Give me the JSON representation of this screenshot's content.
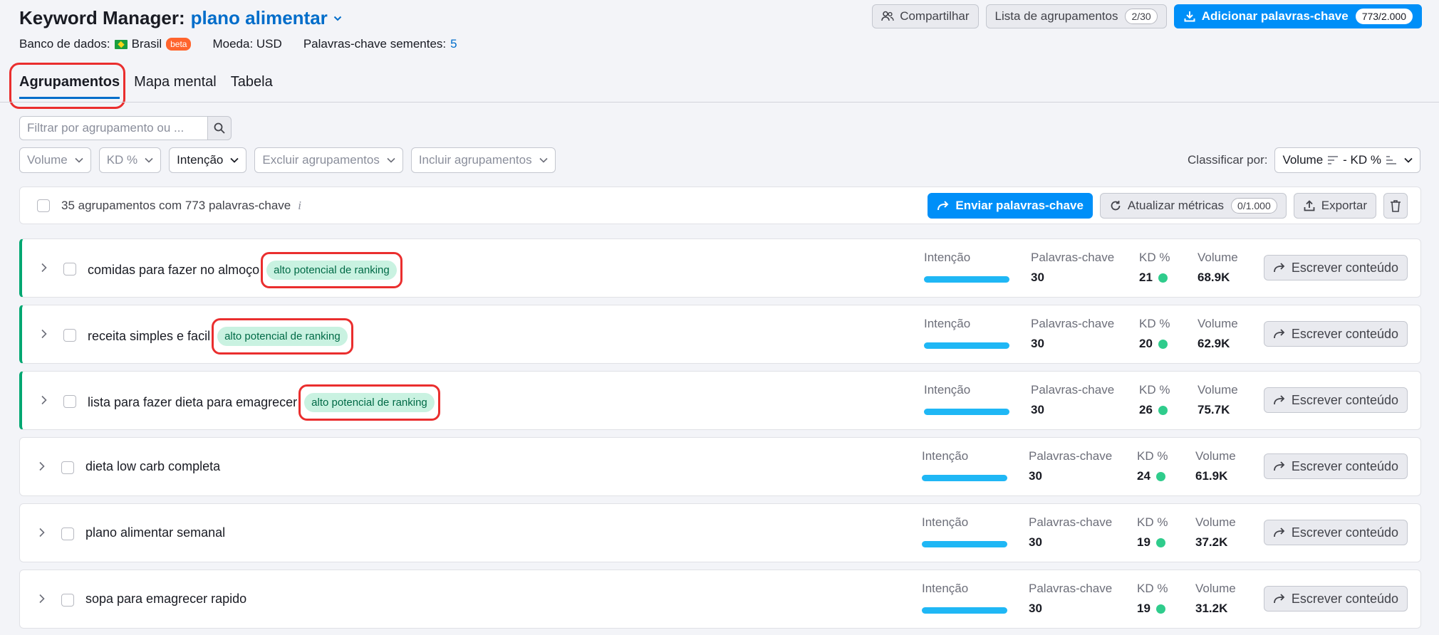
{
  "header": {
    "app_title": "Keyword Manager:",
    "project_name": "plano alimentar",
    "database_label": "Banco de dados:",
    "database_value": "Brasil",
    "beta": "beta",
    "currency": "Moeda: USD",
    "seed_label": "Palavras-chave sementes:",
    "seed_count": "5",
    "share_label": "Compartilhar",
    "groups_list_label": "Lista de agrupamentos",
    "groups_list_count": "2/30",
    "add_keywords_label": "Adicionar palavras-chave",
    "add_keywords_count": "773/2.000"
  },
  "tabs": [
    {
      "label": "Agrupamentos",
      "active": true
    },
    {
      "label": "Mapa mental",
      "active": false
    },
    {
      "label": "Tabela",
      "active": false
    }
  ],
  "search": {
    "placeholder": "Filtrar por agrupamento ou ..."
  },
  "filters": [
    "Volume",
    "KD %",
    "Intenção",
    "Excluir agrupamentos",
    "Incluir agrupamentos"
  ],
  "sort": {
    "label": "Classificar por:",
    "value_a": "Volume",
    "value_b": "- KD %"
  },
  "toolbar": {
    "summary": "35 agrupamentos com 773 palavras-chave",
    "info": "i",
    "send_label": "Enviar palavras-chave",
    "update_label": "Atualizar métricas",
    "update_count": "0/1.000",
    "export_label": "Exportar"
  },
  "labels": {
    "intent": "Intenção",
    "keywords": "Palavras-chave",
    "kd": "KD %",
    "volume": "Volume",
    "write": "Escrever conteúdo"
  },
  "rows": [
    {
      "name": "comidas para fazer no almoço",
      "tag": "alto potencial de ranking",
      "keywords": "30",
      "kd": "21",
      "volume": "68.9K"
    },
    {
      "name": "receita simples e facil",
      "tag": "alto potencial de ranking",
      "keywords": "30",
      "kd": "20",
      "volume": "62.9K"
    },
    {
      "name": "lista para fazer dieta para emagrecer",
      "tag": "alto potencial de ranking",
      "keywords": "30",
      "kd": "26",
      "volume": "75.7K"
    },
    {
      "name": "dieta low carb completa",
      "tag": "",
      "keywords": "30",
      "kd": "24",
      "volume": "61.9K"
    },
    {
      "name": "plano alimentar semanal",
      "tag": "",
      "keywords": "30",
      "kd": "19",
      "volume": "37.2K"
    },
    {
      "name": "sopa para emagrecer rapido",
      "tag": "",
      "keywords": "30",
      "kd": "19",
      "volume": "31.2K"
    }
  ],
  "colors": {
    "accent": "#008ff8",
    "link": "#006dca",
    "row_accent": "#00a771",
    "tag_bg": "#c9f2e1",
    "highlight": "#ea2e2e",
    "kd_dot": "#2fcc8c",
    "intent_bar": "#1fb7f5"
  }
}
